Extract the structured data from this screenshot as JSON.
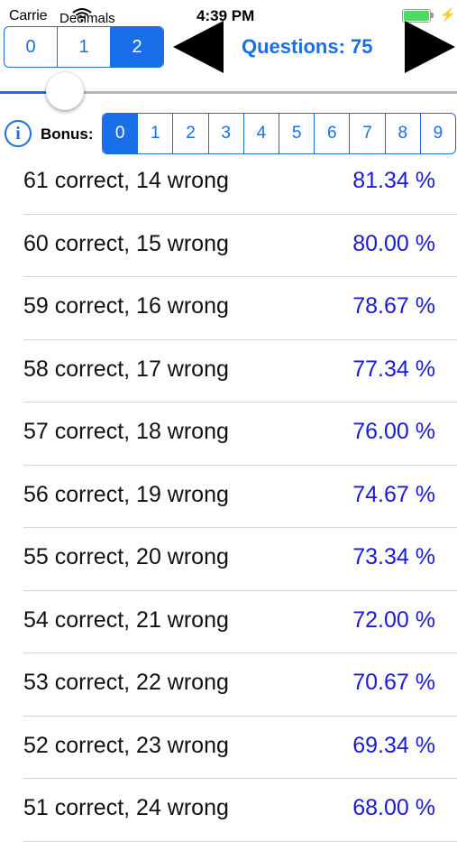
{
  "status_bar": {
    "carrier": "Carrie",
    "time": "4:39 PM"
  },
  "decimals": {
    "label": "Decimals",
    "options": [
      "0",
      "1",
      "2"
    ],
    "selected_index": 2
  },
  "questions": {
    "label": "Questions: 75"
  },
  "slider": {
    "value_fraction": 0.11
  },
  "bonus": {
    "label": "Bonus:",
    "options": [
      "0",
      "1",
      "2",
      "3",
      "4",
      "5",
      "6",
      "7",
      "8",
      "9"
    ],
    "selected_index": 0
  },
  "results": [
    {
      "label": "61 correct, 14 wrong",
      "percent": "81.34 %"
    },
    {
      "label": "60 correct, 15 wrong",
      "percent": "80.00 %"
    },
    {
      "label": "59 correct, 16 wrong",
      "percent": "78.67 %"
    },
    {
      "label": "58 correct, 17 wrong",
      "percent": "77.34 %"
    },
    {
      "label": "57 correct, 18 wrong",
      "percent": "76.00 %"
    },
    {
      "label": "56 correct, 19 wrong",
      "percent": "74.67 %"
    },
    {
      "label": "55 correct, 20 wrong",
      "percent": "73.34 %"
    },
    {
      "label": "54 correct, 21 wrong",
      "percent": "72.00 %"
    },
    {
      "label": "53 correct, 22 wrong",
      "percent": "70.67 %"
    },
    {
      "label": "52 correct, 23 wrong",
      "percent": "69.34 %"
    },
    {
      "label": "51 correct, 24 wrong",
      "percent": "68.00 %"
    }
  ],
  "colors": {
    "accent": "#1a6ee8",
    "percent_text": "#1a1ad8",
    "battery": "#4cd964"
  }
}
